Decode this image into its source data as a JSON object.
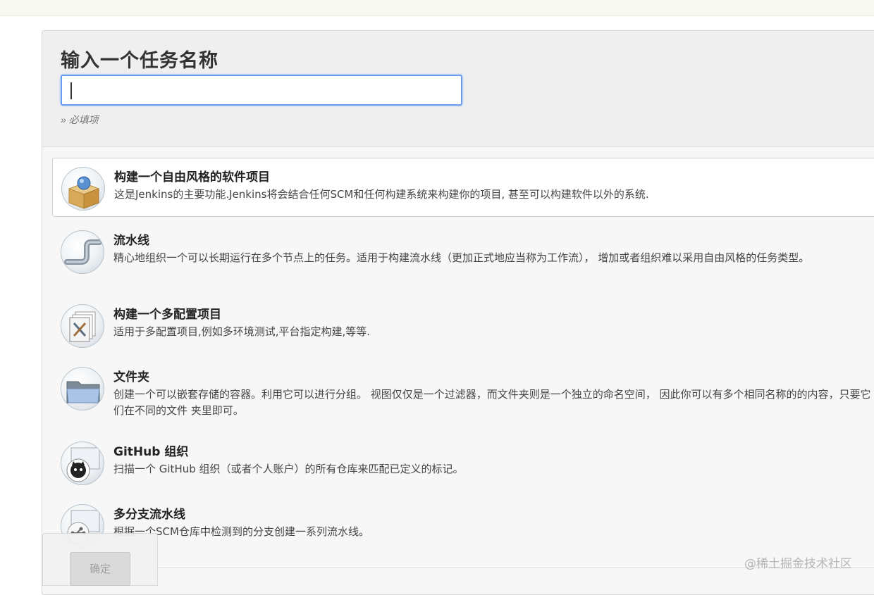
{
  "form": {
    "title": "输入一个任务名称",
    "name_value": "",
    "required_hint": "» 必填项"
  },
  "items": [
    {
      "title": "构建一个自由风格的软件项目",
      "desc": "这是Jenkins的主要功能.Jenkins将会结合任何SCM和任何构建系统来构建你的项目, 甚至可以构建软件以外的系统.",
      "icon": "freestyle-box-icon",
      "selected": true
    },
    {
      "title": "流水线",
      "desc": "精心地组织一个可以长期运行在多个节点上的任务。适用于构建流水线（更加正式地应当称为工作流）， 增加或者组织难以采用自由风格的任务类型。",
      "icon": "pipeline-icon"
    },
    {
      "title": "构建一个多配置项目",
      "desc": "适用于多配置项目,例如多环境测试,平台指定构建,等等.",
      "icon": "multi-config-icon"
    },
    {
      "title": "文件夹",
      "desc": "创建一个可以嵌套存储的容器。利用它可以进行分组。 视图仅仅是一个过滤器，而文件夹则是一个独立的命名空间， 因此你可以有多个相同名称的的内容，只要它们在不同的文件 夹里即可。",
      "icon": "folder-icon"
    },
    {
      "title": "GitHub 组织",
      "desc": "扫描一个 GitHub 组织（或者个人账户）的所有仓库来匹配已定义的标记。",
      "icon": "github-org-icon"
    },
    {
      "title": "多分支流水线",
      "desc": "根据一个SCM仓库中检测到的分支创建一系列流水线。",
      "icon": "multibranch-icon"
    }
  ],
  "footer": {
    "ok_label": "确定"
  },
  "watermark": "@稀土掘金技术社区",
  "colors": {
    "input_focus": "#6a9df0",
    "panel_bg": "#f7f7f7",
    "selected_bg": "#ffffff"
  }
}
